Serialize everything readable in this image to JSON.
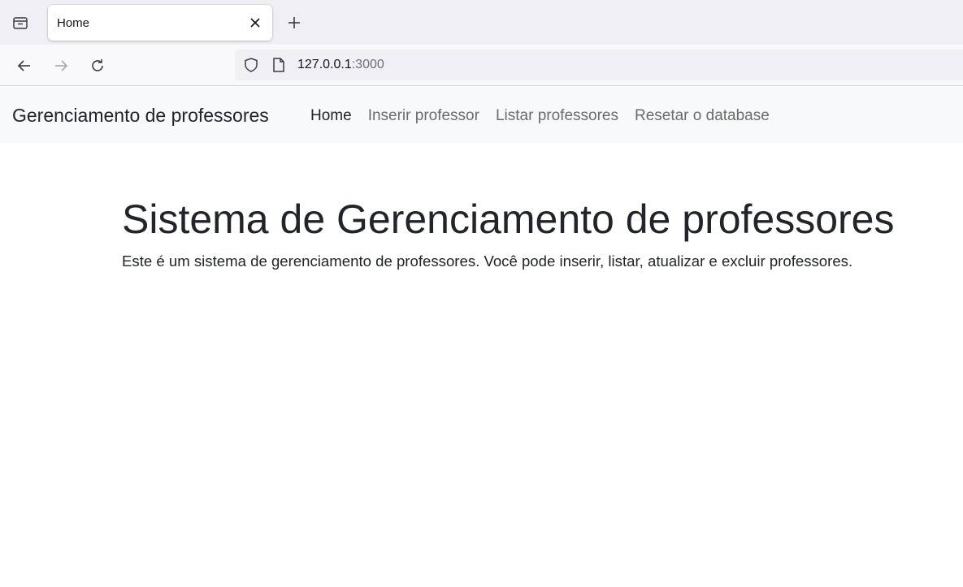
{
  "browser": {
    "tab": {
      "title": "Home"
    },
    "address": {
      "host": "127.0.0.1",
      "port": ":3000"
    }
  },
  "site": {
    "brand": "Gerenciamento de professores",
    "nav": {
      "home": "Home",
      "insert": "Inserir professor",
      "list": "Listar professores",
      "reset": "Resetar o database"
    }
  },
  "main": {
    "title": "Sistema de Gerenciamento de professores",
    "lead": "Este é um sistema de gerenciamento de professores. Você pode inserir, listar, atualizar e excluir professores."
  }
}
